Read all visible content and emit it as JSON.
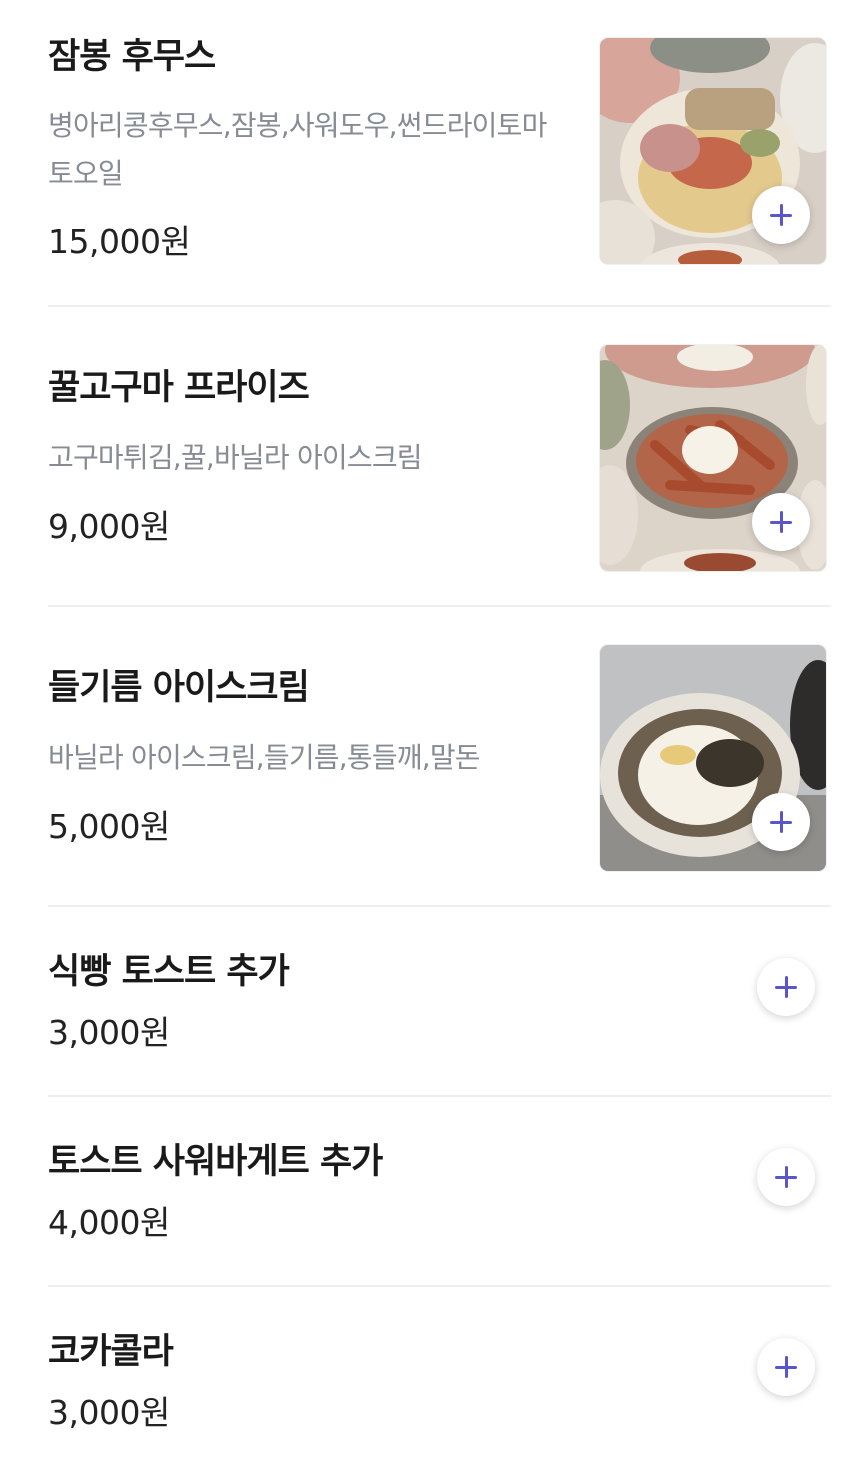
{
  "menu": {
    "items": [
      {
        "name": "잠봉 후무스",
        "description": "병아리콩후무스,잠봉,사워도우,썬드라이토마토오일",
        "price": "15,000원",
        "has_image": true,
        "image": "food-photo-jambon-hummus"
      },
      {
        "name": "꿀고구마 프라이즈",
        "description": "고구마튀김,꿀,바닐라 아이스크림",
        "price": "9,000원",
        "has_image": true,
        "image": "food-photo-honey-sweet-potato-fries"
      },
      {
        "name": "들기름 아이스크림",
        "description": "바닐라 아이스크림,들기름,통들깨,말돈",
        "price": "5,000원",
        "has_image": true,
        "image": "food-photo-perilla-oil-ice-cream"
      },
      {
        "name": "식빵 토스트 추가",
        "description": "",
        "price": "3,000원",
        "has_image": false
      },
      {
        "name": "토스트 사워바게트 추가",
        "description": "",
        "price": "4,000원",
        "has_image": false
      },
      {
        "name": "코카콜라",
        "description": "",
        "price": "3,000원",
        "has_image": false
      }
    ],
    "add_button_icon": "plus-icon",
    "accent_color": "#5a55c9"
  }
}
